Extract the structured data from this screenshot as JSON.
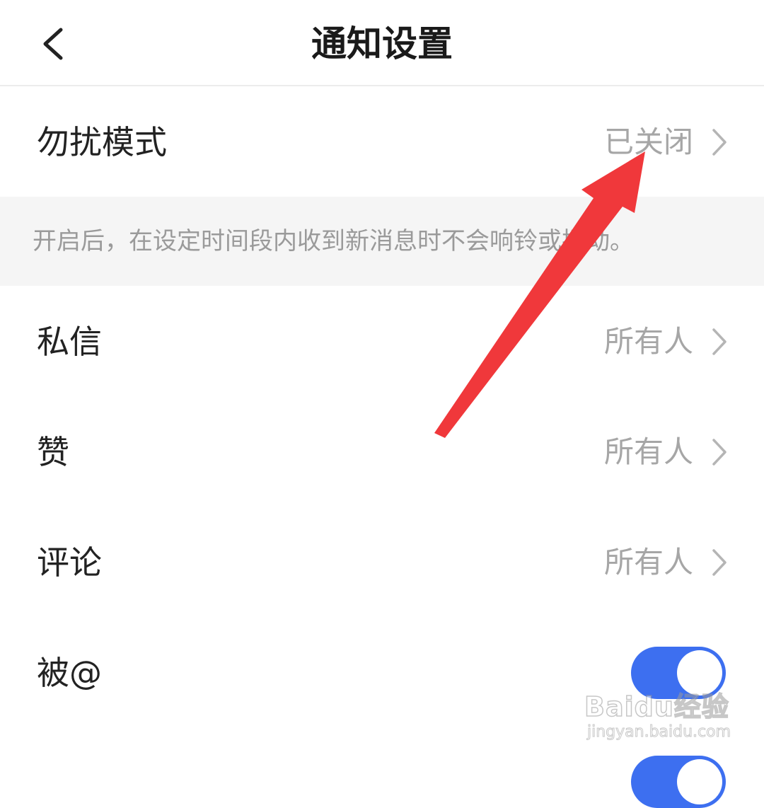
{
  "header": {
    "title": "通知设置",
    "back_icon": "chevron-left-icon"
  },
  "rows": [
    {
      "label": "勿扰模式",
      "value": "已关闭"
    },
    {
      "label": "私信",
      "value": "所有人"
    },
    {
      "label": "赞",
      "value": "所有人"
    },
    {
      "label": "评论",
      "value": "所有人"
    }
  ],
  "dnd_hint": "开启后，在设定时间段内收到新消息时不会响铃或振动。",
  "toggles": [
    {
      "label": "被@",
      "state": "on"
    }
  ],
  "annotation": {
    "type": "red-arrow",
    "color": "#f0383b",
    "points_to": "已关闭"
  },
  "watermark": {
    "main": "Baidu经验",
    "sub": "jingyan.baidu.com"
  },
  "colors": {
    "accent": "#3d6ff0",
    "secondary_text": "#a6a6a6",
    "hint_bg": "#f5f5f5"
  }
}
